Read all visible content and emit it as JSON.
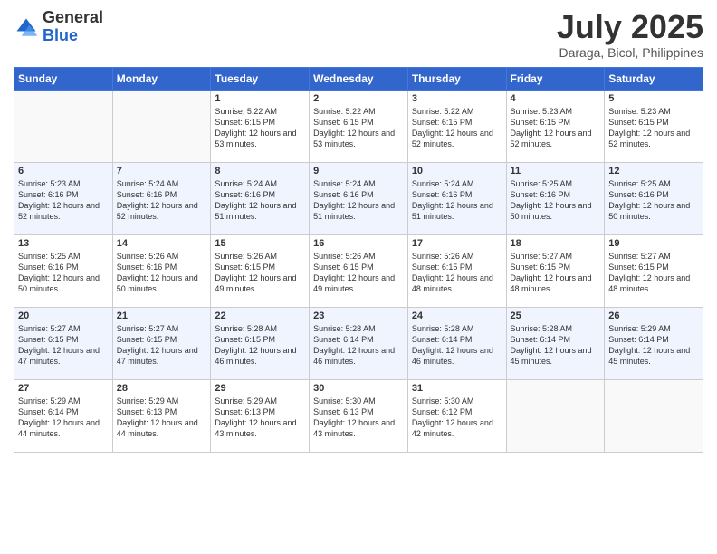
{
  "header": {
    "logo_general": "General",
    "logo_blue": "Blue",
    "month_title": "July 2025",
    "location": "Daraga, Bicol, Philippines"
  },
  "weekdays": [
    "Sunday",
    "Monday",
    "Tuesday",
    "Wednesday",
    "Thursday",
    "Friday",
    "Saturday"
  ],
  "weeks": [
    [
      {
        "day": "",
        "sunrise": "",
        "sunset": "",
        "daylight": ""
      },
      {
        "day": "",
        "sunrise": "",
        "sunset": "",
        "daylight": ""
      },
      {
        "day": "1",
        "sunrise": "Sunrise: 5:22 AM",
        "sunset": "Sunset: 6:15 PM",
        "daylight": "Daylight: 12 hours and 53 minutes."
      },
      {
        "day": "2",
        "sunrise": "Sunrise: 5:22 AM",
        "sunset": "Sunset: 6:15 PM",
        "daylight": "Daylight: 12 hours and 53 minutes."
      },
      {
        "day": "3",
        "sunrise": "Sunrise: 5:22 AM",
        "sunset": "Sunset: 6:15 PM",
        "daylight": "Daylight: 12 hours and 52 minutes."
      },
      {
        "day": "4",
        "sunrise": "Sunrise: 5:23 AM",
        "sunset": "Sunset: 6:15 PM",
        "daylight": "Daylight: 12 hours and 52 minutes."
      },
      {
        "day": "5",
        "sunrise": "Sunrise: 5:23 AM",
        "sunset": "Sunset: 6:15 PM",
        "daylight": "Daylight: 12 hours and 52 minutes."
      }
    ],
    [
      {
        "day": "6",
        "sunrise": "Sunrise: 5:23 AM",
        "sunset": "Sunset: 6:16 PM",
        "daylight": "Daylight: 12 hours and 52 minutes."
      },
      {
        "day": "7",
        "sunrise": "Sunrise: 5:24 AM",
        "sunset": "Sunset: 6:16 PM",
        "daylight": "Daylight: 12 hours and 52 minutes."
      },
      {
        "day": "8",
        "sunrise": "Sunrise: 5:24 AM",
        "sunset": "Sunset: 6:16 PM",
        "daylight": "Daylight: 12 hours and 51 minutes."
      },
      {
        "day": "9",
        "sunrise": "Sunrise: 5:24 AM",
        "sunset": "Sunset: 6:16 PM",
        "daylight": "Daylight: 12 hours and 51 minutes."
      },
      {
        "day": "10",
        "sunrise": "Sunrise: 5:24 AM",
        "sunset": "Sunset: 6:16 PM",
        "daylight": "Daylight: 12 hours and 51 minutes."
      },
      {
        "day": "11",
        "sunrise": "Sunrise: 5:25 AM",
        "sunset": "Sunset: 6:16 PM",
        "daylight": "Daylight: 12 hours and 50 minutes."
      },
      {
        "day": "12",
        "sunrise": "Sunrise: 5:25 AM",
        "sunset": "Sunset: 6:16 PM",
        "daylight": "Daylight: 12 hours and 50 minutes."
      }
    ],
    [
      {
        "day": "13",
        "sunrise": "Sunrise: 5:25 AM",
        "sunset": "Sunset: 6:16 PM",
        "daylight": "Daylight: 12 hours and 50 minutes."
      },
      {
        "day": "14",
        "sunrise": "Sunrise: 5:26 AM",
        "sunset": "Sunset: 6:16 PM",
        "daylight": "Daylight: 12 hours and 50 minutes."
      },
      {
        "day": "15",
        "sunrise": "Sunrise: 5:26 AM",
        "sunset": "Sunset: 6:15 PM",
        "daylight": "Daylight: 12 hours and 49 minutes."
      },
      {
        "day": "16",
        "sunrise": "Sunrise: 5:26 AM",
        "sunset": "Sunset: 6:15 PM",
        "daylight": "Daylight: 12 hours and 49 minutes."
      },
      {
        "day": "17",
        "sunrise": "Sunrise: 5:26 AM",
        "sunset": "Sunset: 6:15 PM",
        "daylight": "Daylight: 12 hours and 48 minutes."
      },
      {
        "day": "18",
        "sunrise": "Sunrise: 5:27 AM",
        "sunset": "Sunset: 6:15 PM",
        "daylight": "Daylight: 12 hours and 48 minutes."
      },
      {
        "day": "19",
        "sunrise": "Sunrise: 5:27 AM",
        "sunset": "Sunset: 6:15 PM",
        "daylight": "Daylight: 12 hours and 48 minutes."
      }
    ],
    [
      {
        "day": "20",
        "sunrise": "Sunrise: 5:27 AM",
        "sunset": "Sunset: 6:15 PM",
        "daylight": "Daylight: 12 hours and 47 minutes."
      },
      {
        "day": "21",
        "sunrise": "Sunrise: 5:27 AM",
        "sunset": "Sunset: 6:15 PM",
        "daylight": "Daylight: 12 hours and 47 minutes."
      },
      {
        "day": "22",
        "sunrise": "Sunrise: 5:28 AM",
        "sunset": "Sunset: 6:15 PM",
        "daylight": "Daylight: 12 hours and 46 minutes."
      },
      {
        "day": "23",
        "sunrise": "Sunrise: 5:28 AM",
        "sunset": "Sunset: 6:14 PM",
        "daylight": "Daylight: 12 hours and 46 minutes."
      },
      {
        "day": "24",
        "sunrise": "Sunrise: 5:28 AM",
        "sunset": "Sunset: 6:14 PM",
        "daylight": "Daylight: 12 hours and 46 minutes."
      },
      {
        "day": "25",
        "sunrise": "Sunrise: 5:28 AM",
        "sunset": "Sunset: 6:14 PM",
        "daylight": "Daylight: 12 hours and 45 minutes."
      },
      {
        "day": "26",
        "sunrise": "Sunrise: 5:29 AM",
        "sunset": "Sunset: 6:14 PM",
        "daylight": "Daylight: 12 hours and 45 minutes."
      }
    ],
    [
      {
        "day": "27",
        "sunrise": "Sunrise: 5:29 AM",
        "sunset": "Sunset: 6:14 PM",
        "daylight": "Daylight: 12 hours and 44 minutes."
      },
      {
        "day": "28",
        "sunrise": "Sunrise: 5:29 AM",
        "sunset": "Sunset: 6:13 PM",
        "daylight": "Daylight: 12 hours and 44 minutes."
      },
      {
        "day": "29",
        "sunrise": "Sunrise: 5:29 AM",
        "sunset": "Sunset: 6:13 PM",
        "daylight": "Daylight: 12 hours and 43 minutes."
      },
      {
        "day": "30",
        "sunrise": "Sunrise: 5:30 AM",
        "sunset": "Sunset: 6:13 PM",
        "daylight": "Daylight: 12 hours and 43 minutes."
      },
      {
        "day": "31",
        "sunrise": "Sunrise: 5:30 AM",
        "sunset": "Sunset: 6:12 PM",
        "daylight": "Daylight: 12 hours and 42 minutes."
      },
      {
        "day": "",
        "sunrise": "",
        "sunset": "",
        "daylight": ""
      },
      {
        "day": "",
        "sunrise": "",
        "sunset": "",
        "daylight": ""
      }
    ]
  ]
}
